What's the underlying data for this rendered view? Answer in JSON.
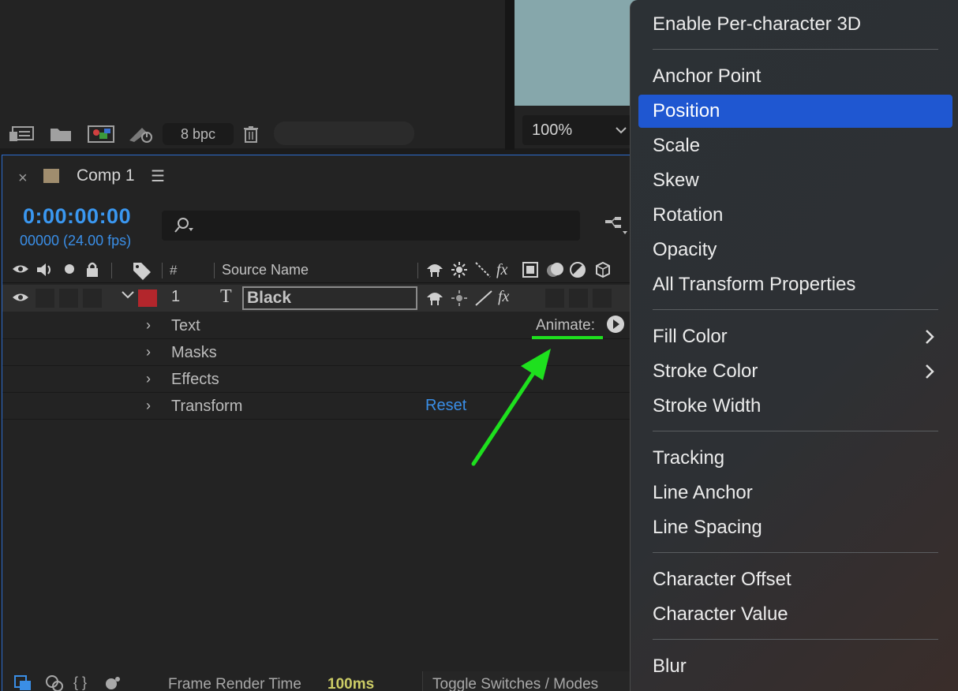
{
  "project_panel": {
    "bpc": "8 bpc",
    "icons": [
      "interpret-footage-icon",
      "folder-icon",
      "new-composition-icon",
      "render-queue-icon",
      "trash-icon"
    ]
  },
  "viewer": {
    "zoom": "100%",
    "canvas_color": "#86a7ab"
  },
  "timeline": {
    "comp_title": "Comp 1",
    "timecode": "0:00:00:00",
    "frames": "00000 (24.00 fps)",
    "columns": {
      "number": "#",
      "source_name": "Source Name"
    },
    "layer": {
      "number": "1",
      "type_glyph": "T",
      "name": "Black",
      "label_color": "#b3262c"
    },
    "properties": [
      {
        "label": "Text"
      },
      {
        "label": "Masks"
      },
      {
        "label": "Effects"
      },
      {
        "label": "Transform"
      }
    ],
    "animate_label": "Animate:",
    "reset_label": "Reset",
    "status": {
      "render_label": "Frame Render Time",
      "render_value": "100ms",
      "toggle_label": "Toggle Switches / Modes"
    },
    "accent": "#3a97f0"
  },
  "context_menu": {
    "items": [
      {
        "label": "Enable Per-character 3D"
      },
      {
        "label": "Anchor Point"
      },
      {
        "label": "Position",
        "active": true
      },
      {
        "label": "Scale"
      },
      {
        "label": "Skew"
      },
      {
        "label": "Rotation"
      },
      {
        "label": "Opacity"
      },
      {
        "label": "All Transform Properties"
      },
      {
        "label": "Fill Color",
        "submenu": true
      },
      {
        "label": "Stroke Color",
        "submenu": true
      },
      {
        "label": "Stroke Width"
      },
      {
        "label": "Tracking"
      },
      {
        "label": "Line Anchor"
      },
      {
        "label": "Line Spacing"
      },
      {
        "label": "Character Offset"
      },
      {
        "label": "Character Value"
      },
      {
        "label": "Blur"
      }
    ],
    "highlight_color": "#1f57d1"
  },
  "annotation": {
    "arrow_color": "#1ee01e"
  }
}
